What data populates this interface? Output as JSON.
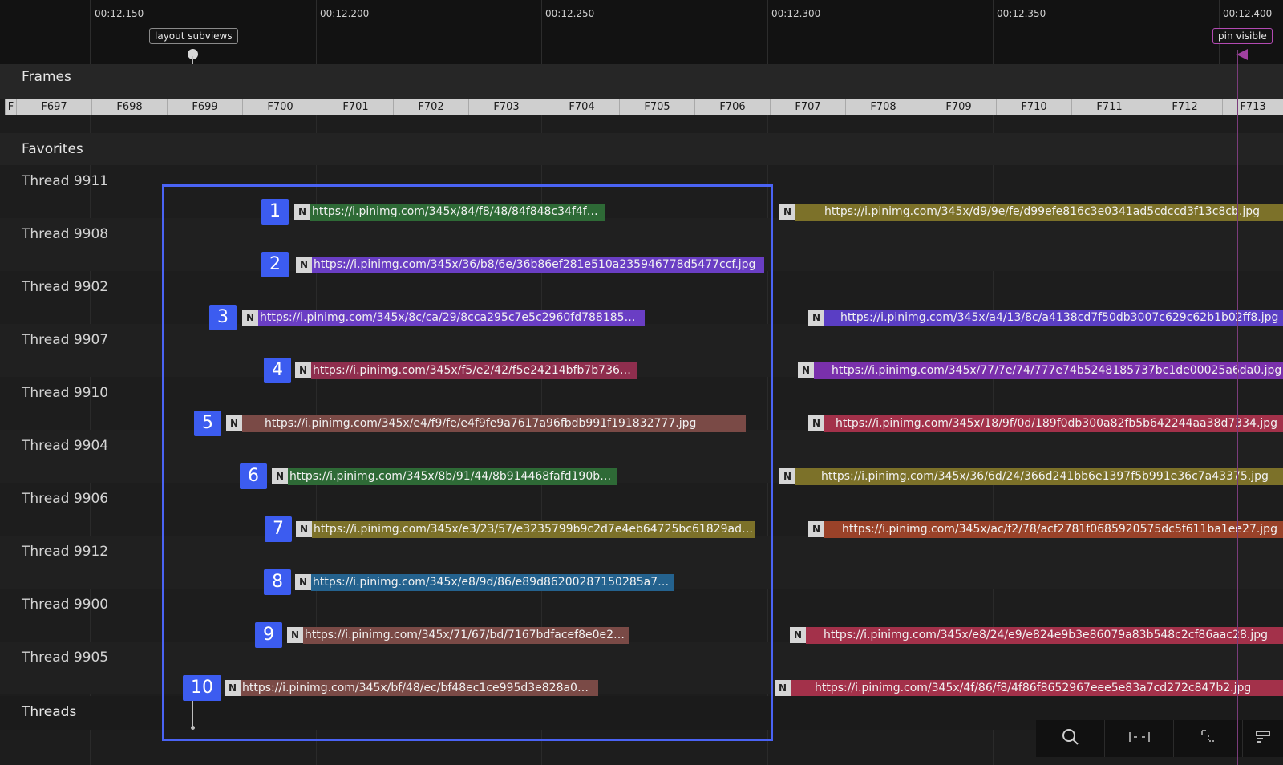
{
  "timeline": {
    "ticks": [
      "00:12.150",
      "00:12.200",
      "00:12.250",
      "00:12.300",
      "00:12.350",
      "00:12.400"
    ],
    "markers": {
      "layout": "layout subviews",
      "pin": "pin visible"
    }
  },
  "sections": {
    "frames": "Frames",
    "favorites": "Favorites",
    "threads": "Threads"
  },
  "frames": [
    "F",
    "F697",
    "F698",
    "F699",
    "F700",
    "F701",
    "F702",
    "F703",
    "F704",
    "F705",
    "F706",
    "F707",
    "F708",
    "F709",
    "F710",
    "F711",
    "F712",
    "F713"
  ],
  "badge_letter": "N",
  "threads": [
    {
      "name": "Thread 9911",
      "num": "1",
      "left_url": "https://i.pinimg.com/345x/84/f8/48/84f848c34f4f…",
      "left_color": "#2e6a36",
      "right_url": "https://i.pinimg.com/345x/d9/9e/fe/d99efe816c3e0341ad5cdccd3f13c8cb.jpg",
      "right_color": "#7c7129"
    },
    {
      "name": "Thread 9908",
      "num": "2",
      "left_url": "https://i.pinimg.com/345x/36/b8/6e/36b86ef281e510a235946778d5477ccf.jpg",
      "left_color": "#6a3ec4",
      "right_url": "",
      "right_color": ""
    },
    {
      "name": "Thread 9902",
      "num": "3",
      "left_url": "https://i.pinimg.com/345x/8c/ca/29/8cca295c7e5c2960fd788185…",
      "left_color": "#6a3ec4",
      "right_url": "https://i.pinimg.com/345x/a4/13/8c/a4138cd7f50db3007c629c62b1b02ff8.jpg",
      "right_color": "#5a3ec4"
    },
    {
      "name": "Thread 9907",
      "num": "4",
      "left_url": "https://i.pinimg.com/345x/f5/e2/42/f5e24214bfb7b7364…",
      "left_color": "#8f2e4e",
      "right_url": "https://i.pinimg.com/345x/77/7e/74/777e74b5248185737bc1de00025a6da0.jpg",
      "right_color": "#7a30ac"
    },
    {
      "name": "Thread 9910",
      "num": "5",
      "left_url": "https://i.pinimg.com/345x/e4/f9/fe/e4f9fe9a7617a96fbdb991f191832777.jpg",
      "left_color": "#7a4a46",
      "right_url": "https://i.pinimg.com/345x/18/9f/0d/189f0db300a82fb5b642244aa38d7334.jpg",
      "right_color": "#a3314a"
    },
    {
      "name": "Thread 9904",
      "num": "6",
      "left_url": "https://i.pinimg.com/345x/8b/91/44/8b914468fafd190ba…",
      "left_color": "#2e6a36",
      "right_url": "https://i.pinimg.com/345x/36/6d/24/366d241bb6e1397f5b991e36c7a43375.jpg",
      "right_color": "#7c7129"
    },
    {
      "name": "Thread 9906",
      "num": "7",
      "left_url": "https://i.pinimg.com/345x/e3/23/57/e3235799b9c2d7e4eb64725bc61829ad…",
      "left_color": "#7c7129",
      "right_url": "https://i.pinimg.com/345x/ac/f2/78/acf2781f0685920575dc5f611ba1ee27.jpg",
      "right_color": "#9a4229"
    },
    {
      "name": "Thread 9912",
      "num": "8",
      "left_url": "https://i.pinimg.com/345x/e8/9d/86/e89d86200287150285a7…",
      "left_color": "#24628e",
      "right_url": "",
      "right_color": ""
    },
    {
      "name": "Thread 9900",
      "num": "9",
      "left_url": "https://i.pinimg.com/345x/71/67/bd/7167bdfacef8e0e20…",
      "left_color": "#7a4a46",
      "right_url": "https://i.pinimg.com/345x/e8/24/e9/e824e9b3e86079a83b548c2cf86aac28.jpg",
      "right_color": "#a3314a"
    },
    {
      "name": "Thread 9905",
      "num": "10",
      "left_url": "https://i.pinimg.com/345x/bf/48/ec/bf48ec1ce995d3e828a0…",
      "left_color": "#7a4a46",
      "right_url": "https://i.pinimg.com/345x/4f/86/f8/4f86f8652967eee5e83a7cd272c847b2.jpg",
      "right_color": "#a3314a"
    }
  ],
  "toolbar": {
    "icons": [
      "search-icon",
      "fit-range-icon",
      "crop-selection-icon",
      "panel-toggle-icon"
    ]
  },
  "colors": {
    "selection": "#4a63f4",
    "pin": "#a040a0",
    "badge": "#3c5cf0"
  }
}
